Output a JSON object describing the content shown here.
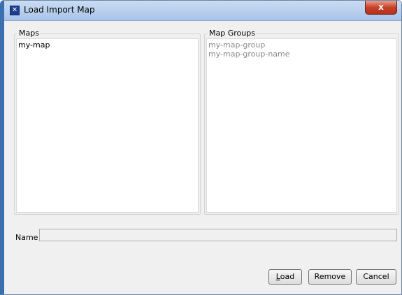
{
  "window": {
    "title": "Load Import Map",
    "close_label": "x"
  },
  "maps": {
    "label": "Maps",
    "items": [
      "my-map"
    ]
  },
  "map_groups": {
    "label": "Map Groups",
    "items": [
      "my-map-group",
      "my-map-group-name"
    ]
  },
  "name_field": {
    "label": "Name",
    "value": ""
  },
  "buttons": {
    "load_mnemonic": "L",
    "load_rest": "oad",
    "remove": "Remove",
    "cancel": "Cancel"
  },
  "colors": {
    "titlebar": "#b9d1ee",
    "close_button": "#c7422a",
    "disabled_text": "#8a8a8a"
  }
}
